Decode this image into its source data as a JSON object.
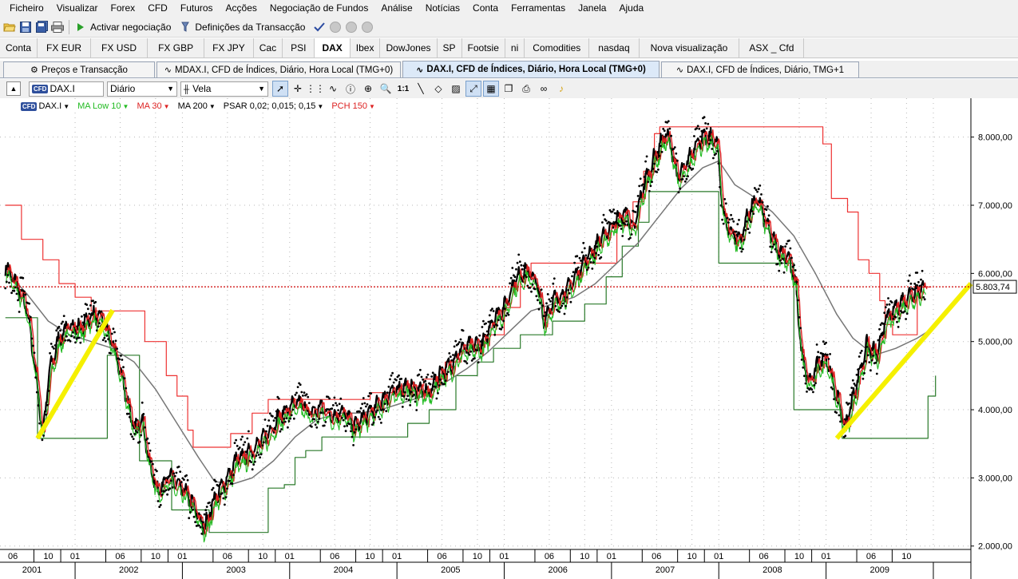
{
  "menu": [
    "Ficheiro",
    "Visualizar",
    "Forex",
    "CFD",
    "Futuros",
    "Acções",
    "Negociação de Fundos",
    "Análise",
    "Notícias",
    "Conta",
    "Ferramentas",
    "Janela",
    "Ajuda"
  ],
  "toolbar": {
    "activate_trading": "Activar negociação",
    "transaction_settings": "Definições da Transacção"
  },
  "symbol_tabs": [
    "Conta",
    "FX EUR",
    "FX USD",
    "FX GBP",
    "FX JPY",
    "Cac",
    "PSI",
    "DAX",
    "Ibex",
    "DowJones",
    "SP",
    "Footsie",
    "ni",
    "Comodities",
    "nasdaq",
    "Nova visualização",
    "ASX _ Cfd"
  ],
  "active_symbol_tab": "DAX",
  "chart_tabs": [
    "Preços e Transacção",
    "MDAX.I, CFD de Índices, Diário, Hora Local (TMG+0)",
    "DAX.I, CFD de Índices, Diário, Hora Local (TMG+0)",
    "DAX.I, CFD de Índices, Diário, TMG+1"
  ],
  "active_chart_tab": 2,
  "chart_toolbar": {
    "symbol": "DAX.I",
    "symbol_badge": "CFD",
    "period": "Diário",
    "chart_type": "Vela"
  },
  "indicators": [
    {
      "label": "DAX.I",
      "color": "#000000"
    },
    {
      "label": "MA Low 10",
      "color": "#22bb22"
    },
    {
      "label": "MA 30",
      "color": "#dd2222"
    },
    {
      "label": "MA 200",
      "color": "#000000"
    },
    {
      "label": "PSAR 0,02; 0,015; 0,15",
      "color": "#000000"
    },
    {
      "label": "PCH 150",
      "color": "#dd2222"
    }
  ],
  "chart_data": {
    "type": "line",
    "y_ticks": [
      "8.000,00",
      "7.000,00",
      "6.000,00",
      "5.000,00",
      "4.000,00",
      "3.000,00",
      "2.000,00"
    ],
    "y_tick_values": [
      8000,
      7000,
      6000,
      5000,
      4000,
      3000,
      2000
    ],
    "ylim": [
      1950,
      8570
    ],
    "x_months": [
      "06",
      "10",
      "01",
      "06",
      "10",
      "01",
      "06",
      "10",
      "01",
      "06",
      "10",
      "01",
      "06",
      "10",
      "01",
      "06",
      "10",
      "01",
      "06",
      "10",
      "01",
      "06",
      "10",
      "01",
      "06",
      "10"
    ],
    "x_years": [
      "2001",
      "2002",
      "2003",
      "2004",
      "2005",
      "2006",
      "2007",
      "2008",
      "2009"
    ],
    "last_price_label": "5.803,74",
    "last_price": 5803.74,
    "grid": true,
    "colors": {
      "price": "#000000",
      "ma_low_10": "#22bb22",
      "ma_30": "#dd2222",
      "ma_200": "#777777",
      "pch_upper": "#ee3333",
      "pch_lower": "#2a7a2a",
      "trendline": "#f5f000",
      "last_price_line": "#cc0000"
    },
    "series": [
      {
        "name": "DAX.I",
        "points": [
          [
            2001.35,
            6100
          ],
          [
            2001.45,
            5850
          ],
          [
            2001.55,
            5500
          ],
          [
            2001.62,
            4700
          ],
          [
            2001.7,
            3650
          ],
          [
            2001.76,
            4550
          ],
          [
            2001.85,
            5050
          ],
          [
            2001.95,
            5250
          ],
          [
            2002.05,
            5200
          ],
          [
            2002.15,
            5400
          ],
          [
            2002.25,
            5350
          ],
          [
            2002.35,
            4950
          ],
          [
            2002.45,
            4400
          ],
          [
            2002.55,
            3700
          ],
          [
            2002.62,
            3900
          ],
          [
            2002.7,
            3150
          ],
          [
            2002.78,
            2800
          ],
          [
            2002.86,
            3050
          ],
          [
            2002.95,
            2900
          ],
          [
            2003.05,
            2750
          ],
          [
            2003.15,
            2450
          ],
          [
            2003.2,
            2250
          ],
          [
            2003.3,
            2700
          ],
          [
            2003.4,
            2950
          ],
          [
            2003.5,
            3250
          ],
          [
            2003.6,
            3350
          ],
          [
            2003.7,
            3500
          ],
          [
            2003.8,
            3650
          ],
          [
            2003.9,
            3900
          ],
          [
            2004.0,
            4050
          ],
          [
            2004.1,
            4100
          ],
          [
            2004.2,
            3950
          ],
          [
            2004.3,
            4050
          ],
          [
            2004.4,
            3900
          ],
          [
            2004.5,
            4000
          ],
          [
            2004.6,
            3750
          ],
          [
            2004.7,
            3900
          ],
          [
            2004.8,
            4050
          ],
          [
            2004.9,
            4200
          ],
          [
            2005.0,
            4300
          ],
          [
            2005.1,
            4350
          ],
          [
            2005.2,
            4300
          ],
          [
            2005.3,
            4250
          ],
          [
            2005.4,
            4550
          ],
          [
            2005.5,
            4650
          ],
          [
            2005.6,
            4900
          ],
          [
            2005.7,
            4950
          ],
          [
            2005.8,
            4950
          ],
          [
            2005.9,
            5350
          ],
          [
            2006.0,
            5500
          ],
          [
            2006.1,
            5900
          ],
          [
            2006.2,
            6050
          ],
          [
            2006.3,
            5900
          ],
          [
            2006.37,
            5300
          ],
          [
            2006.45,
            5600
          ],
          [
            2006.55,
            5700
          ],
          [
            2006.65,
            5900
          ],
          [
            2006.75,
            6200
          ],
          [
            2006.85,
            6400
          ],
          [
            2006.95,
            6600
          ],
          [
            2007.05,
            6800
          ],
          [
            2007.15,
            6900
          ],
          [
            2007.2,
            6600
          ],
          [
            2007.3,
            7300
          ],
          [
            2007.4,
            7700
          ],
          [
            2007.5,
            8050
          ],
          [
            2007.55,
            7900
          ],
          [
            2007.62,
            7400
          ],
          [
            2007.7,
            7600
          ],
          [
            2007.8,
            7950
          ],
          [
            2007.9,
            8000
          ],
          [
            2007.98,
            7950
          ],
          [
            2008.05,
            6800
          ],
          [
            2008.12,
            6600
          ],
          [
            2008.2,
            6500
          ],
          [
            2008.28,
            6900
          ],
          [
            2008.36,
            7100
          ],
          [
            2008.45,
            6700
          ],
          [
            2008.55,
            6350
          ],
          [
            2008.65,
            6250
          ],
          [
            2008.72,
            5800
          ],
          [
            2008.78,
            4700
          ],
          [
            2008.85,
            4400
          ],
          [
            2008.92,
            4650
          ],
          [
            2009.0,
            4800
          ],
          [
            2009.08,
            4300
          ],
          [
            2009.18,
            3750
          ],
          [
            2009.28,
            4350
          ],
          [
            2009.38,
            4950
          ],
          [
            2009.48,
            4800
          ],
          [
            2009.55,
            5300
          ],
          [
            2009.65,
            5500
          ],
          [
            2009.75,
            5650
          ],
          [
            2009.85,
            5750
          ],
          [
            2009.92,
            5800
          ]
        ]
      },
      {
        "name": "MA 200",
        "points": [
          [
            2001.35,
            6050
          ],
          [
            2001.55,
            5700
          ],
          [
            2001.75,
            5300
          ],
          [
            2001.95,
            5100
          ],
          [
            2002.15,
            5000
          ],
          [
            2002.35,
            4900
          ],
          [
            2002.55,
            4700
          ],
          [
            2002.75,
            4300
          ],
          [
            2002.95,
            3800
          ],
          [
            2003.15,
            3300
          ],
          [
            2003.3,
            2950
          ],
          [
            2003.45,
            2900
          ],
          [
            2003.65,
            3000
          ],
          [
            2003.85,
            3250
          ],
          [
            2004.05,
            3600
          ],
          [
            2004.25,
            3850
          ],
          [
            2004.45,
            3950
          ],
          [
            2004.65,
            3950
          ],
          [
            2004.85,
            4000
          ],
          [
            2005.05,
            4100
          ],
          [
            2005.25,
            4200
          ],
          [
            2005.45,
            4400
          ],
          [
            2005.65,
            4600
          ],
          [
            2005.85,
            4850
          ],
          [
            2006.05,
            5150
          ],
          [
            2006.25,
            5450
          ],
          [
            2006.45,
            5550
          ],
          [
            2006.65,
            5650
          ],
          [
            2006.85,
            5850
          ],
          [
            2007.05,
            6150
          ],
          [
            2007.25,
            6450
          ],
          [
            2007.45,
            6850
          ],
          [
            2007.65,
            7250
          ],
          [
            2007.85,
            7550
          ],
          [
            2008.0,
            7650
          ],
          [
            2008.15,
            7300
          ],
          [
            2008.3,
            7150
          ],
          [
            2008.5,
            6900
          ],
          [
            2008.7,
            6550
          ],
          [
            2008.9,
            6000
          ],
          [
            2009.1,
            5400
          ],
          [
            2009.25,
            5050
          ],
          [
            2009.45,
            4800
          ],
          [
            2009.65,
            4900
          ],
          [
            2009.85,
            5050
          ],
          [
            2009.95,
            5150
          ]
        ]
      },
      {
        "name": "PCH 150 upper",
        "points": [
          [
            2001.35,
            7000
          ],
          [
            2001.5,
            6500
          ],
          [
            2001.7,
            6200
          ],
          [
            2001.85,
            5850
          ],
          [
            2002.0,
            5650
          ],
          [
            2002.15,
            5450
          ],
          [
            2002.55,
            5450
          ],
          [
            2002.65,
            5000
          ],
          [
            2002.85,
            4500
          ],
          [
            2002.95,
            4200
          ],
          [
            2003.05,
            3700
          ],
          [
            2003.1,
            3450
          ],
          [
            2003.3,
            3450
          ],
          [
            2003.45,
            3650
          ],
          [
            2003.65,
            3950
          ],
          [
            2003.8,
            4150
          ],
          [
            2004.6,
            4150
          ],
          [
            2004.75,
            4250
          ],
          [
            2005.0,
            4350
          ],
          [
            2005.25,
            4450
          ],
          [
            2005.45,
            4700
          ],
          [
            2005.6,
            4950
          ],
          [
            2005.8,
            5100
          ],
          [
            2006.0,
            5500
          ],
          [
            2006.15,
            5950
          ],
          [
            2006.25,
            6150
          ],
          [
            2006.9,
            6150
          ],
          [
            2007.05,
            6700
          ],
          [
            2007.2,
            7050
          ],
          [
            2007.3,
            7500
          ],
          [
            2007.4,
            8050
          ],
          [
            2007.45,
            8150
          ],
          [
            2008.9,
            8150
          ],
          [
            2008.97,
            7900
          ],
          [
            2009.05,
            7100
          ],
          [
            2009.2,
            6900
          ],
          [
            2009.3,
            6200
          ],
          [
            2009.4,
            6000
          ],
          [
            2009.5,
            5600
          ],
          [
            2009.55,
            5250
          ],
          [
            2009.62,
            5100
          ],
          [
            2009.75,
            5100
          ],
          [
            2009.85,
            5800
          ],
          [
            2009.98,
            5800
          ]
        ]
      },
      {
        "name": "PCH 150 lower",
        "points": [
          [
            2001.35,
            5350
          ],
          [
            2001.5,
            5350
          ],
          [
            2001.65,
            3580
          ],
          [
            2002.25,
            3580
          ],
          [
            2002.3,
            4800
          ],
          [
            2002.55,
            4800
          ],
          [
            2002.6,
            3250
          ],
          [
            2002.85,
            3250
          ],
          [
            2002.9,
            2530
          ],
          [
            2003.2,
            2530
          ],
          [
            2003.25,
            2200
          ],
          [
            2003.75,
            2200
          ],
          [
            2003.8,
            2850
          ],
          [
            2003.95,
            2900
          ],
          [
            2004.05,
            3300
          ],
          [
            2004.15,
            3400
          ],
          [
            2004.3,
            3600
          ],
          [
            2004.6,
            3600
          ],
          [
            2005.0,
            3600
          ],
          [
            2005.1,
            3800
          ],
          [
            2005.3,
            4000
          ],
          [
            2005.55,
            4500
          ],
          [
            2005.75,
            4700
          ],
          [
            2005.9,
            4900
          ],
          [
            2006.15,
            5100
          ],
          [
            2006.45,
            5300
          ],
          [
            2006.75,
            5550
          ],
          [
            2006.95,
            5950
          ],
          [
            2007.1,
            6400
          ],
          [
            2007.25,
            6750
          ],
          [
            2007.35,
            7200
          ],
          [
            2007.95,
            7200
          ],
          [
            2008.0,
            6150
          ],
          [
            2008.6,
            6150
          ],
          [
            2008.7,
            4000
          ],
          [
            2009.1,
            4000
          ],
          [
            2009.15,
            3580
          ],
          [
            2009.85,
            3580
          ],
          [
            2009.95,
            4200
          ],
          [
            2010.02,
            4500
          ]
        ]
      }
    ],
    "annotations": [
      {
        "type": "trendline",
        "from": [
          2001.65,
          3580
        ],
        "to": [
          2002.35,
          5460
        ]
      },
      {
        "type": "trendline",
        "from": [
          2009.1,
          3580
        ],
        "to": [
          2010.35,
          5850
        ]
      }
    ]
  }
}
